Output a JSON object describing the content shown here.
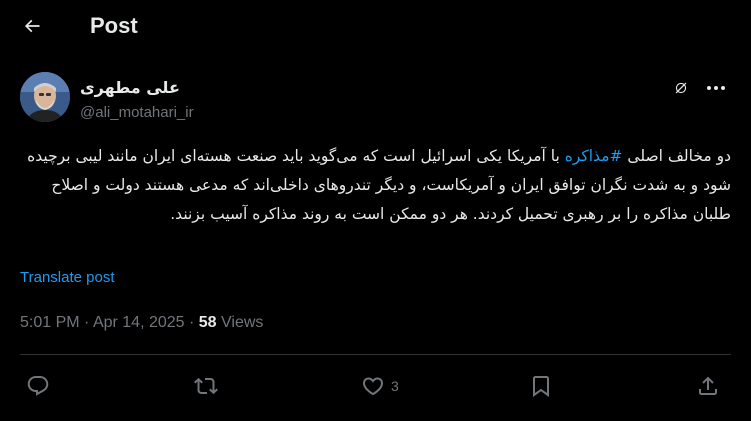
{
  "header": {
    "title": "Post"
  },
  "author": {
    "name": "علی مطهری",
    "handle": "@ali_motahari_ir"
  },
  "post": {
    "text_before": "دو مخالف اصلی ",
    "hashtag": "#مذاکره",
    "text_after": " با آمریکا یکی اسرائیل است که می‌گوید باید صنعت هسته‌ای ایران مانند لیبی برچیده شود و به شدت نگران توافق ایران و آمریکاست، و دیگر تندروهای داخلی‌اند که مدعی هستند دولت و اصلاح طلبان مذاکره را بر رهبری تحمیل کردند. هر دو ممکن است به روند مذاکره آسیب بزنند.",
    "translate_label": "Translate post"
  },
  "meta": {
    "time": "5:01 PM",
    "separator1": " · ",
    "date": "Apr 14, 2025",
    "separator2": " · ",
    "views_count": "58",
    "views_label": " Views"
  },
  "actions": {
    "like_count": "3"
  },
  "icons": {
    "back": "arrow-left-icon",
    "grok": "grok-icon",
    "more": "more-icon",
    "reply": "reply-icon",
    "repost": "repost-icon",
    "like": "heart-icon",
    "bookmark": "bookmark-icon",
    "share": "share-icon"
  },
  "colors": {
    "background": "#000000",
    "text": "#e7e9ea",
    "muted": "#71767b",
    "accent": "#1d9bf0",
    "divider": "#2f3336"
  }
}
